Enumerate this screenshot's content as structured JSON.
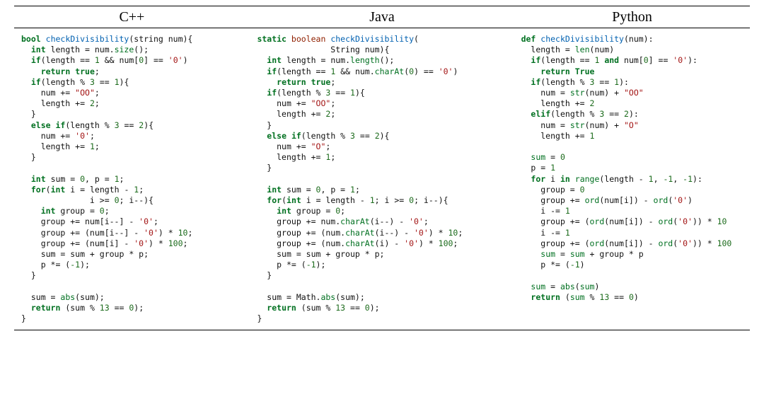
{
  "headers": {
    "cpp": "C++",
    "java": "Java",
    "python": "Python"
  },
  "cpp_tokens": [
    [
      [
        "kw",
        "bool"
      ],
      [
        "",
        " "
      ],
      [
        "fn",
        "checkDivisibility"
      ],
      [
        "",
        "(string num){"
      ]
    ],
    [
      [
        "",
        "  "
      ],
      [
        "kw",
        "int"
      ],
      [
        "",
        " length = num."
      ],
      [
        "bi",
        "size"
      ],
      [
        "",
        "();"
      ]
    ],
    [
      [
        "",
        "  "
      ],
      [
        "kw",
        "if"
      ],
      [
        "",
        "(length == "
      ],
      [
        "num",
        "1"
      ],
      [
        "",
        " && num["
      ],
      [
        "num",
        "0"
      ],
      [
        "",
        "] == "
      ],
      [
        "str",
        "'0'"
      ],
      [
        "",
        ")"
      ]
    ],
    [
      [
        "",
        "    "
      ],
      [
        "kw",
        "return"
      ],
      [
        "",
        " "
      ],
      [
        "kw",
        "true"
      ],
      [
        "",
        ";"
      ]
    ],
    [
      [
        "",
        "  "
      ],
      [
        "kw",
        "if"
      ],
      [
        "",
        "(length % "
      ],
      [
        "num",
        "3"
      ],
      [
        "",
        " == "
      ],
      [
        "num",
        "1"
      ],
      [
        "",
        "){"
      ]
    ],
    [
      [
        "",
        "    num += "
      ],
      [
        "str",
        "\"OO\""
      ],
      [
        "",
        ";"
      ]
    ],
    [
      [
        "",
        "    length += "
      ],
      [
        "num",
        "2"
      ],
      [
        "",
        ";"
      ]
    ],
    [
      [
        "",
        "  }"
      ]
    ],
    [
      [
        "",
        "  "
      ],
      [
        "kw",
        "else"
      ],
      [
        "",
        " "
      ],
      [
        "kw",
        "if"
      ],
      [
        "",
        "(length % "
      ],
      [
        "num",
        "3"
      ],
      [
        "",
        " == "
      ],
      [
        "num",
        "2"
      ],
      [
        "",
        "){"
      ]
    ],
    [
      [
        "",
        "    num += "
      ],
      [
        "str",
        "'0'"
      ],
      [
        "",
        ";"
      ]
    ],
    [
      [
        "",
        "    length += "
      ],
      [
        "num",
        "1"
      ],
      [
        "",
        ";"
      ]
    ],
    [
      [
        "",
        "  }"
      ]
    ],
    [
      [
        "",
        ""
      ]
    ],
    [
      [
        "",
        "  "
      ],
      [
        "kw",
        "int"
      ],
      [
        "",
        " sum = "
      ],
      [
        "num",
        "0"
      ],
      [
        "",
        ", p = "
      ],
      [
        "num",
        "1"
      ],
      [
        "",
        ";"
      ]
    ],
    [
      [
        "",
        "  "
      ],
      [
        "kw",
        "for"
      ],
      [
        "",
        "("
      ],
      [
        "kw",
        "int"
      ],
      [
        "",
        " i = length - "
      ],
      [
        "num",
        "1"
      ],
      [
        "",
        ";"
      ]
    ],
    [
      [
        "",
        "              i >= "
      ],
      [
        "num",
        "0"
      ],
      [
        "",
        "; i--){"
      ]
    ],
    [
      [
        "",
        "    "
      ],
      [
        "kw",
        "int"
      ],
      [
        "",
        " group = "
      ],
      [
        "num",
        "0"
      ],
      [
        "",
        ";"
      ]
    ],
    [
      [
        "",
        "    group += num[i--] - "
      ],
      [
        "str",
        "'0'"
      ],
      [
        "",
        ";"
      ]
    ],
    [
      [
        "",
        "    group += (num[i--] - "
      ],
      [
        "str",
        "'0'"
      ],
      [
        "",
        ") * "
      ],
      [
        "num",
        "10"
      ],
      [
        "",
        ";"
      ]
    ],
    [
      [
        "",
        "    group += (num[i] - "
      ],
      [
        "str",
        "'0'"
      ],
      [
        "",
        ") * "
      ],
      [
        "num",
        "100"
      ],
      [
        "",
        ";"
      ]
    ],
    [
      [
        "",
        "    sum = sum + group * p;"
      ]
    ],
    [
      [
        "",
        "    p *= ("
      ],
      [
        "num",
        "-1"
      ],
      [
        "",
        ");"
      ]
    ],
    [
      [
        "",
        "  }"
      ]
    ],
    [
      [
        "",
        ""
      ]
    ],
    [
      [
        "",
        "  sum = "
      ],
      [
        "bi",
        "abs"
      ],
      [
        "",
        "(sum);"
      ]
    ],
    [
      [
        "",
        "  "
      ],
      [
        "kw",
        "return"
      ],
      [
        "",
        " (sum % "
      ],
      [
        "num",
        "13"
      ],
      [
        "",
        " == "
      ],
      [
        "num",
        "0"
      ],
      [
        "",
        ");"
      ]
    ],
    [
      [
        "",
        "}"
      ]
    ]
  ],
  "java_tokens": [
    [
      [
        "kw",
        "static"
      ],
      [
        "",
        " "
      ],
      [
        "ty",
        "boolean"
      ],
      [
        "",
        " "
      ],
      [
        "fn",
        "checkDivisibility"
      ],
      [
        "",
        "("
      ]
    ],
    [
      [
        "",
        "               String num){"
      ]
    ],
    [
      [
        "",
        "  "
      ],
      [
        "kw",
        "int"
      ],
      [
        "",
        " length = num."
      ],
      [
        "bi",
        "length"
      ],
      [
        "",
        "();"
      ]
    ],
    [
      [
        "",
        "  "
      ],
      [
        "kw",
        "if"
      ],
      [
        "",
        "(length == "
      ],
      [
        "num",
        "1"
      ],
      [
        "",
        " && num."
      ],
      [
        "bi",
        "charAt"
      ],
      [
        "",
        "("
      ],
      [
        "num",
        "0"
      ],
      [
        "",
        ") == "
      ],
      [
        "str",
        "'0'"
      ],
      [
        "",
        ")"
      ]
    ],
    [
      [
        "",
        "    "
      ],
      [
        "kw",
        "return"
      ],
      [
        "",
        " "
      ],
      [
        "kw",
        "true"
      ],
      [
        "",
        ";"
      ]
    ],
    [
      [
        "",
        "  "
      ],
      [
        "kw",
        "if"
      ],
      [
        "",
        "(length % "
      ],
      [
        "num",
        "3"
      ],
      [
        "",
        " == "
      ],
      [
        "num",
        "1"
      ],
      [
        "",
        "){"
      ]
    ],
    [
      [
        "",
        "    num += "
      ],
      [
        "str",
        "\"OO\""
      ],
      [
        "",
        ";"
      ]
    ],
    [
      [
        "",
        "    length += "
      ],
      [
        "num",
        "2"
      ],
      [
        "",
        ";"
      ]
    ],
    [
      [
        "",
        "  }"
      ]
    ],
    [
      [
        "",
        "  "
      ],
      [
        "kw",
        "else"
      ],
      [
        "",
        " "
      ],
      [
        "kw",
        "if"
      ],
      [
        "",
        "(length % "
      ],
      [
        "num",
        "3"
      ],
      [
        "",
        " == "
      ],
      [
        "num",
        "2"
      ],
      [
        "",
        "){"
      ]
    ],
    [
      [
        "",
        "    num += "
      ],
      [
        "str",
        "\"O\""
      ],
      [
        "",
        ";"
      ]
    ],
    [
      [
        "",
        "    length += "
      ],
      [
        "num",
        "1"
      ],
      [
        "",
        ";"
      ]
    ],
    [
      [
        "",
        "  }"
      ]
    ],
    [
      [
        "",
        ""
      ]
    ],
    [
      [
        "",
        "  "
      ],
      [
        "kw",
        "int"
      ],
      [
        "",
        " sum = "
      ],
      [
        "num",
        "0"
      ],
      [
        "",
        ", p = "
      ],
      [
        "num",
        "1"
      ],
      [
        "",
        ";"
      ]
    ],
    [
      [
        "",
        "  "
      ],
      [
        "kw",
        "for"
      ],
      [
        "",
        "("
      ],
      [
        "kw",
        "int"
      ],
      [
        "",
        " i = length - "
      ],
      [
        "num",
        "1"
      ],
      [
        "",
        "; i >= "
      ],
      [
        "num",
        "0"
      ],
      [
        "",
        "; i--){"
      ]
    ],
    [
      [
        "",
        "    "
      ],
      [
        "kw",
        "int"
      ],
      [
        "",
        " group = "
      ],
      [
        "num",
        "0"
      ],
      [
        "",
        ";"
      ]
    ],
    [
      [
        "",
        "    group += num."
      ],
      [
        "bi",
        "charAt"
      ],
      [
        "",
        "(i--) - "
      ],
      [
        "str",
        "'0'"
      ],
      [
        "",
        ";"
      ]
    ],
    [
      [
        "",
        "    group += (num."
      ],
      [
        "bi",
        "charAt"
      ],
      [
        "",
        "(i--) - "
      ],
      [
        "str",
        "'0'"
      ],
      [
        "",
        ") * "
      ],
      [
        "num",
        "10"
      ],
      [
        "",
        ";"
      ]
    ],
    [
      [
        "",
        "    group += (num."
      ],
      [
        "bi",
        "charAt"
      ],
      [
        "",
        "(i) - "
      ],
      [
        "str",
        "'0'"
      ],
      [
        "",
        ") * "
      ],
      [
        "num",
        "100"
      ],
      [
        "",
        ";"
      ]
    ],
    [
      [
        "",
        "    sum = sum + group * p;"
      ]
    ],
    [
      [
        "",
        "    p *= ("
      ],
      [
        "num",
        "-1"
      ],
      [
        "",
        ");"
      ]
    ],
    [
      [
        "",
        "  }"
      ]
    ],
    [
      [
        "",
        ""
      ]
    ],
    [
      [
        "",
        "  sum = Math."
      ],
      [
        "bi",
        "abs"
      ],
      [
        "",
        "(sum);"
      ]
    ],
    [
      [
        "",
        "  "
      ],
      [
        "kw",
        "return"
      ],
      [
        "",
        " (sum % "
      ],
      [
        "num",
        "13"
      ],
      [
        "",
        " == "
      ],
      [
        "num",
        "0"
      ],
      [
        "",
        ");"
      ]
    ],
    [
      [
        "",
        "}"
      ]
    ]
  ],
  "python_tokens": [
    [
      [
        "kw",
        "def"
      ],
      [
        "",
        " "
      ],
      [
        "fn",
        "checkDivisibility"
      ],
      [
        "",
        "(num):"
      ]
    ],
    [
      [
        "",
        "  length = "
      ],
      [
        "bi",
        "len"
      ],
      [
        "",
        "(num)"
      ]
    ],
    [
      [
        "",
        "  "
      ],
      [
        "kw",
        "if"
      ],
      [
        "",
        "(length == "
      ],
      [
        "num",
        "1"
      ],
      [
        "",
        " "
      ],
      [
        "kw",
        "and"
      ],
      [
        "",
        " num["
      ],
      [
        "num",
        "0"
      ],
      [
        "",
        "] == "
      ],
      [
        "str",
        "'0'"
      ],
      [
        "",
        "):"
      ]
    ],
    [
      [
        "",
        "    "
      ],
      [
        "kw",
        "return"
      ],
      [
        "",
        " "
      ],
      [
        "kw",
        "True"
      ]
    ],
    [
      [
        "",
        "  "
      ],
      [
        "kw",
        "if"
      ],
      [
        "",
        "(length % "
      ],
      [
        "num",
        "3"
      ],
      [
        "",
        " == "
      ],
      [
        "num",
        "1"
      ],
      [
        "",
        "):"
      ]
    ],
    [
      [
        "",
        "    num = "
      ],
      [
        "bi",
        "str"
      ],
      [
        "",
        "(num) + "
      ],
      [
        "str",
        "\"OO\""
      ]
    ],
    [
      [
        "",
        "    length += "
      ],
      [
        "num",
        "2"
      ]
    ],
    [
      [
        "",
        "  "
      ],
      [
        "kw",
        "elif"
      ],
      [
        "",
        "(length % "
      ],
      [
        "num",
        "3"
      ],
      [
        "",
        " == "
      ],
      [
        "num",
        "2"
      ],
      [
        "",
        "):"
      ]
    ],
    [
      [
        "",
        "    num = "
      ],
      [
        "bi",
        "str"
      ],
      [
        "",
        "(num) + "
      ],
      [
        "str",
        "\"O\""
      ]
    ],
    [
      [
        "",
        "    length += "
      ],
      [
        "num",
        "1"
      ]
    ],
    [
      [
        "",
        ""
      ]
    ],
    [
      [
        "",
        "  "
      ],
      [
        "bi",
        "sum"
      ],
      [
        "",
        " = "
      ],
      [
        "num",
        "0"
      ]
    ],
    [
      [
        "",
        "  p = "
      ],
      [
        "num",
        "1"
      ]
    ],
    [
      [
        "",
        "  "
      ],
      [
        "kw",
        "for"
      ],
      [
        "",
        " i "
      ],
      [
        "kw",
        "in"
      ],
      [
        "",
        " "
      ],
      [
        "bi",
        "range"
      ],
      [
        "",
        "(length - "
      ],
      [
        "num",
        "1"
      ],
      [
        "",
        ", "
      ],
      [
        "num",
        "-1"
      ],
      [
        "",
        ", "
      ],
      [
        "num",
        "-1"
      ],
      [
        "",
        "):"
      ]
    ],
    [
      [
        "",
        "    group = "
      ],
      [
        "num",
        "0"
      ]
    ],
    [
      [
        "",
        "    group += "
      ],
      [
        "bi",
        "ord"
      ],
      [
        "",
        "(num[i]) - "
      ],
      [
        "bi",
        "ord"
      ],
      [
        "",
        "("
      ],
      [
        "str",
        "'0'"
      ],
      [
        "",
        ")"
      ]
    ],
    [
      [
        "",
        "    i -= "
      ],
      [
        "num",
        "1"
      ]
    ],
    [
      [
        "",
        "    group += ("
      ],
      [
        "bi",
        "ord"
      ],
      [
        "",
        "(num[i]) - "
      ],
      [
        "bi",
        "ord"
      ],
      [
        "",
        "("
      ],
      [
        "str",
        "'0'"
      ],
      [
        "",
        ")) * "
      ],
      [
        "num",
        "10"
      ]
    ],
    [
      [
        "",
        "    i -= "
      ],
      [
        "num",
        "1"
      ]
    ],
    [
      [
        "",
        "    group += ("
      ],
      [
        "bi",
        "ord"
      ],
      [
        "",
        "(num[i]) - "
      ],
      [
        "bi",
        "ord"
      ],
      [
        "",
        "("
      ],
      [
        "str",
        "'0'"
      ],
      [
        "",
        ")) * "
      ],
      [
        "num",
        "100"
      ]
    ],
    [
      [
        "",
        "    "
      ],
      [
        "bi",
        "sum"
      ],
      [
        "",
        " = "
      ],
      [
        "bi",
        "sum"
      ],
      [
        "",
        " + group * p"
      ]
    ],
    [
      [
        "",
        "    p *= ("
      ],
      [
        "num",
        "-1"
      ],
      [
        "",
        ")"
      ]
    ],
    [
      [
        "",
        ""
      ]
    ],
    [
      [
        "",
        "  "
      ],
      [
        "bi",
        "sum"
      ],
      [
        "",
        " = "
      ],
      [
        "bi",
        "abs"
      ],
      [
        "",
        "("
      ],
      [
        "bi",
        "sum"
      ],
      [
        "",
        ")"
      ]
    ],
    [
      [
        "",
        "  "
      ],
      [
        "kw",
        "return"
      ],
      [
        "",
        " ("
      ],
      [
        "bi",
        "sum"
      ],
      [
        "",
        " % "
      ],
      [
        "num",
        "13"
      ],
      [
        "",
        " == "
      ],
      [
        "num",
        "0"
      ],
      [
        "",
        ")"
      ]
    ]
  ]
}
